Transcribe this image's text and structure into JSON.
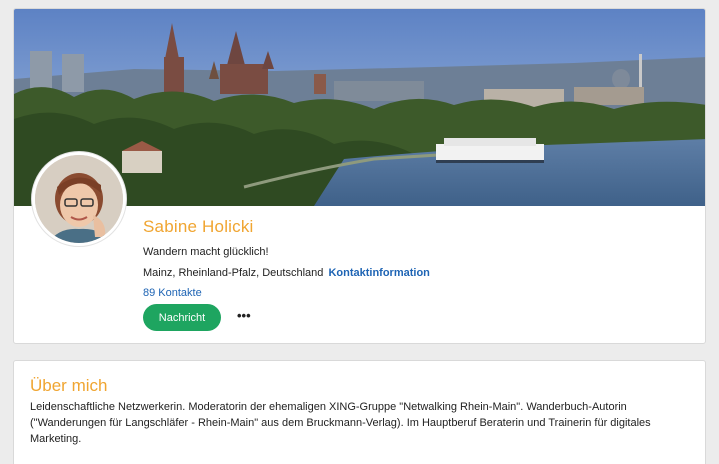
{
  "profile": {
    "name": "Sabine Holicki",
    "headline": "Wandern macht glücklich!",
    "location": "Mainz, Rheinland-Pfalz, Deutschland",
    "contact_info_link": "Kontaktinformation",
    "contacts_count": "89 Kontakte",
    "message_button": "Nachricht",
    "more_button": "•••"
  },
  "about": {
    "title": "Über mich",
    "text": "Leidenschaftliche Netzwerkerin. Moderatorin der ehemaligen XING-Gruppe \"Netwalking Rhein-Main\". Wanderbuch-Autorin (\"Wanderungen für Langschläfer - Rhein-Main\" aus dem Bruckmann-Verlag). Im Hauptberuf Beraterin und Trainerin für digitales Marketing."
  },
  "colors": {
    "accent": "#f0a531",
    "link": "#1e64b4",
    "button": "#1ea560"
  }
}
